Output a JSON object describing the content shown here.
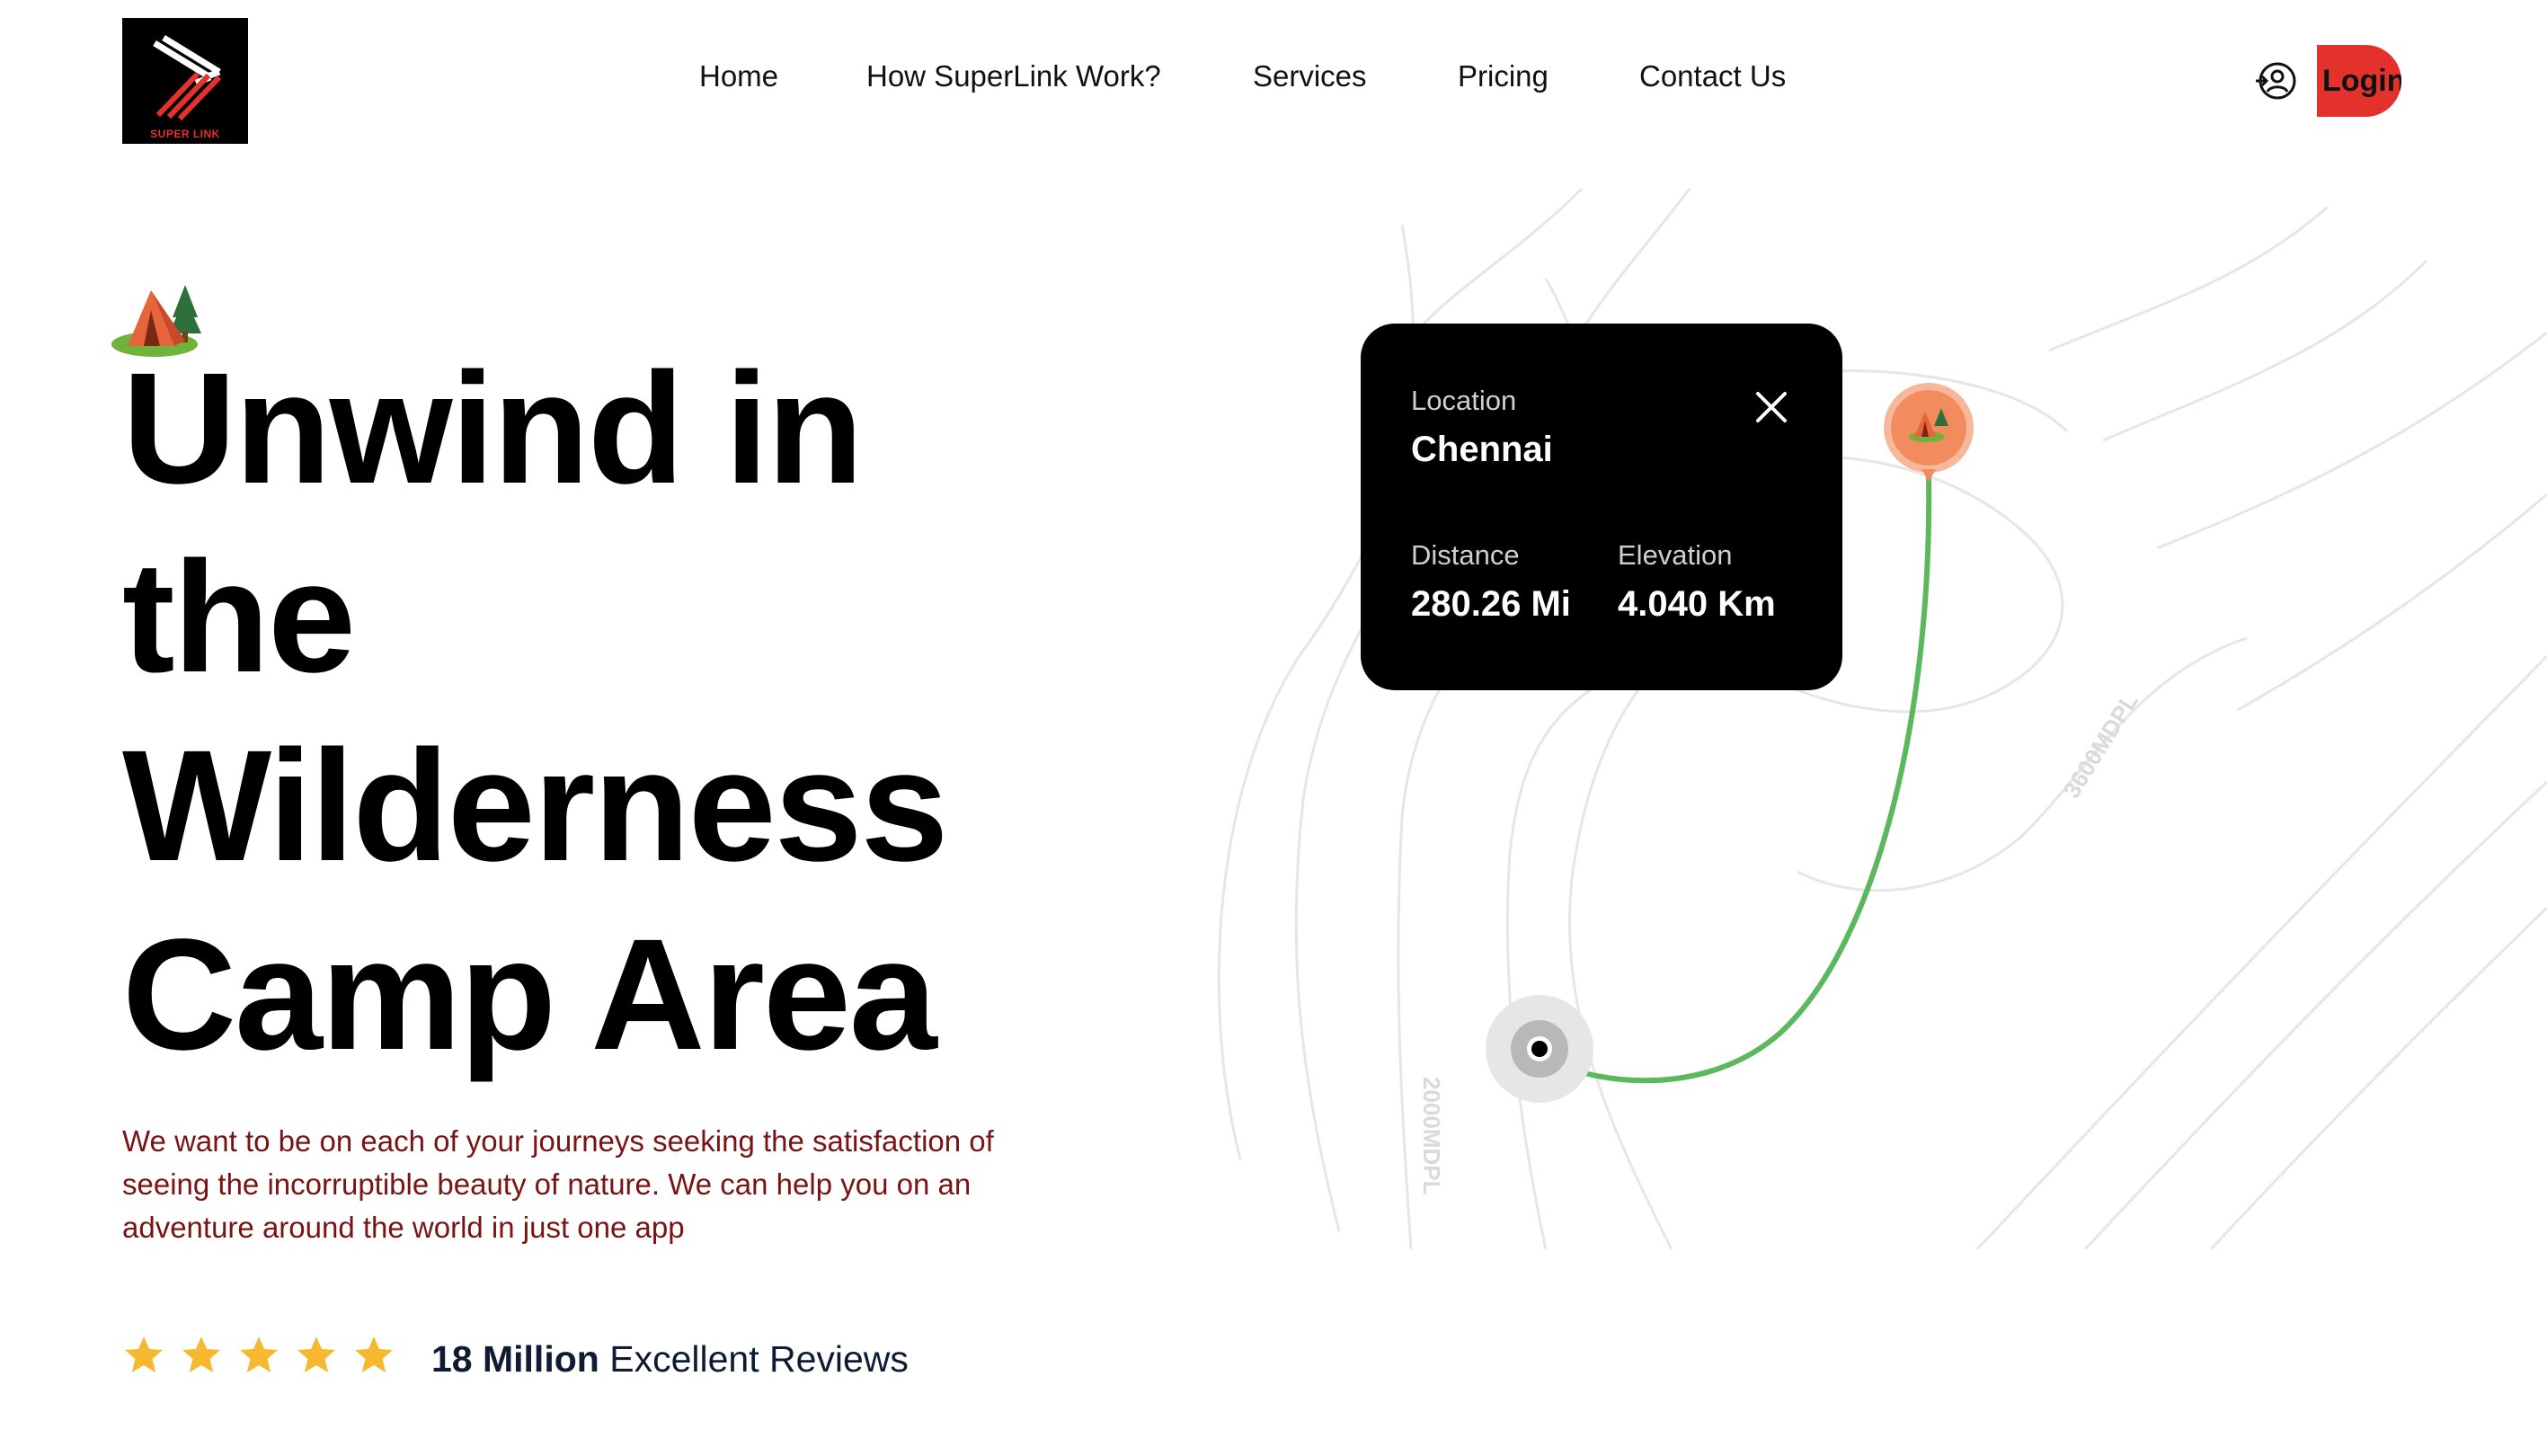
{
  "brand": {
    "logo_text": "SUPER LINK"
  },
  "nav": {
    "items": [
      {
        "label": "Home"
      },
      {
        "label": "How SuperLink Work?"
      },
      {
        "label": "Services"
      },
      {
        "label": "Pricing"
      },
      {
        "label": "Contact Us"
      }
    ]
  },
  "header": {
    "login_label": "Login",
    "login_icon": "user-circle-login-icon"
  },
  "hero": {
    "title_lines": [
      "Unwind in",
      "the",
      "Wilderness",
      "Camp Area"
    ],
    "description": "We want to be on each of your journeys seeking the satisfaction of seeing the incorruptible beauty of nature. We can help you on an adventure around the world in just one app",
    "rating": {
      "stars": 5,
      "count": "18 Million",
      "label": "Excellent Reviews"
    }
  },
  "map": {
    "contour_labels": [
      "3600MDPL",
      "2000MDPL"
    ],
    "info_card": {
      "location_label": "Location",
      "location_value": "Chennai",
      "distance_label": "Distance",
      "distance_value": "280.26 Mi",
      "elevation_label": "Elevation",
      "elevation_value": "4.040 Km"
    }
  },
  "colors": {
    "accent": "#e2322b",
    "route": "#5cb85c",
    "pin": "#f28c5e",
    "star": "#f5b82e",
    "description": "#7a1414",
    "reviews": "#0f1b33"
  }
}
